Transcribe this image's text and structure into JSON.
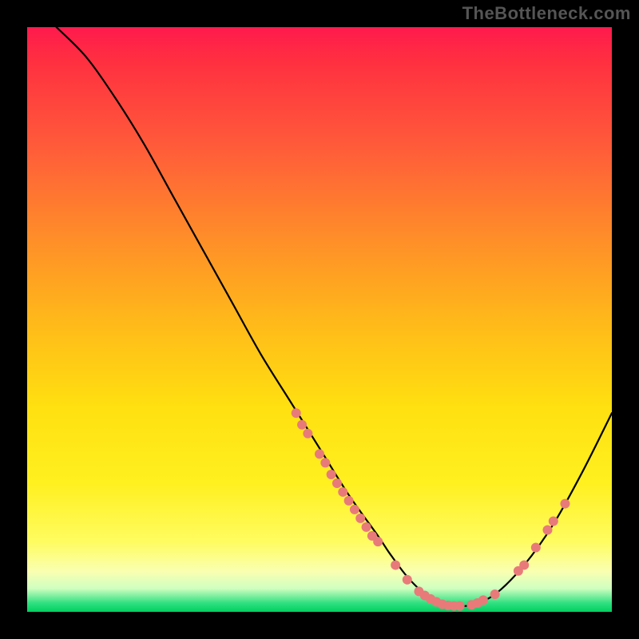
{
  "watermark": "TheBottleneck.com",
  "chart_data": {
    "type": "line",
    "title": "",
    "xlabel": "",
    "ylabel": "",
    "xlim": [
      0,
      100
    ],
    "ylim": [
      0,
      100
    ],
    "grid": false,
    "legend": false,
    "series": [
      {
        "name": "curve",
        "x": [
          5,
          10,
          15,
          20,
          25,
          30,
          35,
          40,
          45,
          50,
          55,
          60,
          62,
          65,
          68,
          70,
          73,
          76,
          80,
          85,
          90,
          95,
          100
        ],
        "y": [
          100,
          95,
          88,
          80,
          71,
          62,
          53,
          44,
          36,
          28,
          20,
          13,
          10,
          6,
          3,
          1.5,
          1,
          1.2,
          3,
          8,
          15,
          24,
          34
        ]
      }
    ],
    "markers": [
      {
        "x": 46,
        "y": 34
      },
      {
        "x": 47,
        "y": 32
      },
      {
        "x": 48,
        "y": 30.5
      },
      {
        "x": 50,
        "y": 27
      },
      {
        "x": 51,
        "y": 25.5
      },
      {
        "x": 52,
        "y": 23.5
      },
      {
        "x": 53,
        "y": 22
      },
      {
        "x": 54,
        "y": 20.5
      },
      {
        "x": 55,
        "y": 19
      },
      {
        "x": 56,
        "y": 17.5
      },
      {
        "x": 57,
        "y": 16
      },
      {
        "x": 58,
        "y": 14.5
      },
      {
        "x": 59,
        "y": 13
      },
      {
        "x": 60,
        "y": 12
      },
      {
        "x": 63,
        "y": 8
      },
      {
        "x": 65,
        "y": 5.5
      },
      {
        "x": 67,
        "y": 3.5
      },
      {
        "x": 68,
        "y": 2.8
      },
      {
        "x": 69,
        "y": 2.2
      },
      {
        "x": 70,
        "y": 1.7
      },
      {
        "x": 71,
        "y": 1.3
      },
      {
        "x": 72,
        "y": 1.1
      },
      {
        "x": 73,
        "y": 1.0
      },
      {
        "x": 74,
        "y": 1.0
      },
      {
        "x": 76,
        "y": 1.2
      },
      {
        "x": 77,
        "y": 1.5
      },
      {
        "x": 78,
        "y": 2.0
      },
      {
        "x": 80,
        "y": 3.0
      },
      {
        "x": 84,
        "y": 7
      },
      {
        "x": 85,
        "y": 8
      },
      {
        "x": 87,
        "y": 11
      },
      {
        "x": 89,
        "y": 14
      },
      {
        "x": 90,
        "y": 15.5
      },
      {
        "x": 92,
        "y": 18.5
      }
    ],
    "colors": {
      "curve": "#000000",
      "marker_fill": "#e87a7a",
      "marker_stroke": "#d85a5a"
    }
  }
}
